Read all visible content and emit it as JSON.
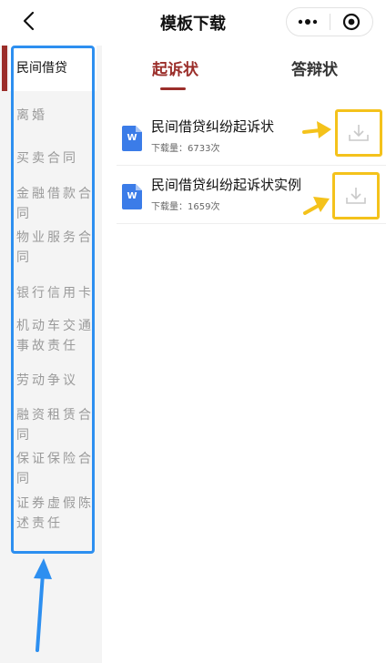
{
  "navbar": {
    "title": "模板下载",
    "back_icon": "chevron-left-icon",
    "more_icon": "more-dots-icon",
    "close_icon": "target-circle-icon"
  },
  "sidebar": {
    "items": [
      {
        "label": "民间借贷",
        "active": true
      },
      {
        "label": "离婚"
      },
      {
        "label": "买卖合同"
      },
      {
        "label": "金融借款合同"
      },
      {
        "label": "物业服务合同"
      },
      {
        "label": "银行信用卡"
      },
      {
        "label": "机动车交通事故责任"
      },
      {
        "label": "劳动争议"
      },
      {
        "label": "融资租赁合同"
      },
      {
        "label": "保证保险合同"
      },
      {
        "label": "证券虚假陈述责任"
      }
    ]
  },
  "tabs": {
    "items": [
      {
        "label": "起诉状",
        "active": true
      },
      {
        "label": "答辩状",
        "active": false
      }
    ]
  },
  "documents": [
    {
      "title": "民间借贷纠纷起诉状",
      "count": "下载量：6733次",
      "icon": "word-doc-icon",
      "badge": "W"
    },
    {
      "title": "民间借贷纠纷起诉状实例",
      "count": "下载量：1659次",
      "icon": "word-doc-icon",
      "badge": "W"
    }
  ],
  "colors": {
    "accent": "#9b2e2a",
    "highlight_blue": "#2d8ff0",
    "highlight_yellow": "#f4c21b",
    "word_blue": "#3b7ce8"
  }
}
